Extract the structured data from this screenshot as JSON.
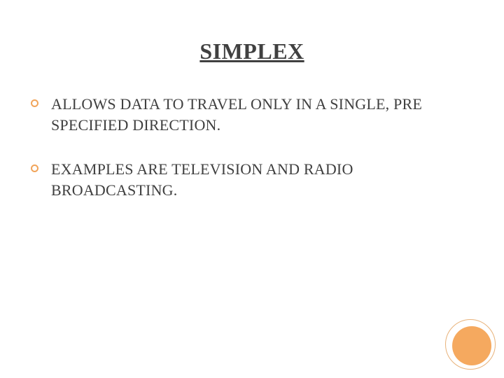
{
  "title": "SIMPLEX",
  "bullets": [
    "ALLOWS DATA TO TRAVEL ONLY IN A SINGLE, PRE SPECIFIED DIRECTION.",
    "EXAMPLES ARE TELEVISION AND RADIO BROADCASTING."
  ],
  "colors": {
    "accent": "#f5a95f",
    "text": "#3f3f3f"
  }
}
